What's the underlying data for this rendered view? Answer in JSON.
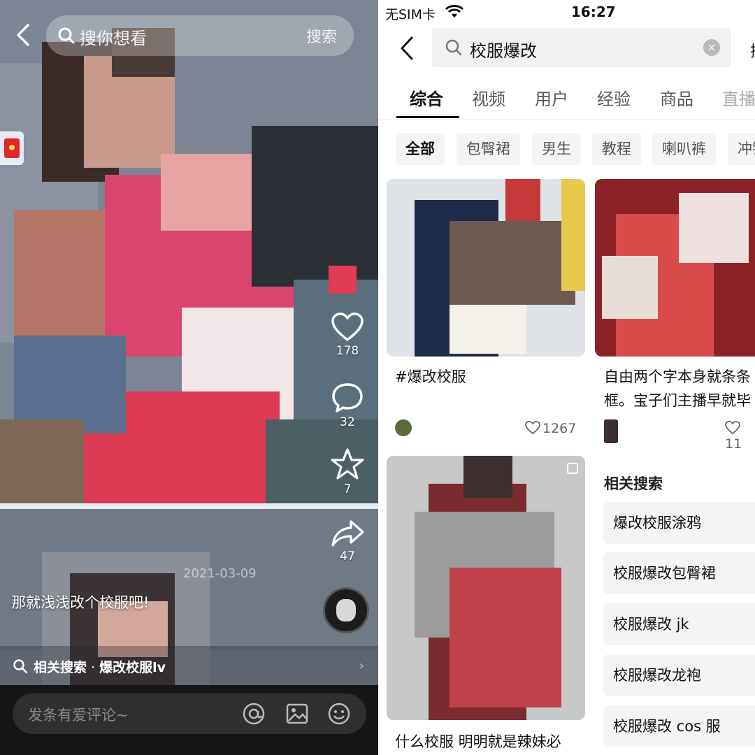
{
  "left_panel": {
    "search_placeholder": "搜你想看",
    "search_button": "搜索",
    "rail": {
      "likes": "178",
      "comments": "32",
      "favorites": "7",
      "shares": "47"
    },
    "caption": "那就浅浅改个校服吧!",
    "date": "2021-03-09",
    "related": {
      "label": "相关搜索",
      "separator": " · ",
      "query": "爆改校服lv"
    },
    "comment_placeholder": "发条有爱评论~",
    "icons": [
      "back-icon",
      "search-icon",
      "red-packet-icon",
      "heart-icon",
      "comment-icon",
      "star-icon",
      "share-icon",
      "at-icon",
      "image-icon",
      "emoji-icon"
    ]
  },
  "right_panel": {
    "status": {
      "carrier": "无SIM卡",
      "time": "16:27"
    },
    "search": {
      "query": "校服爆改",
      "button": "搜"
    },
    "tabs": [
      "综合",
      "视频",
      "用户",
      "经验",
      "商品",
      "直播"
    ],
    "active_tab": "综合",
    "chips": [
      "全部",
      "包臀裙",
      "男生",
      "教程",
      "喇叭裤",
      "冲锋"
    ],
    "active_chip": "全部",
    "cards": [
      {
        "title": "#爆改校服",
        "likes": "1267"
      },
      {
        "title_lines": [
          "自由两个字本身就条条",
          "框。宝子们主播早就毕"
        ],
        "likes": "11"
      },
      {
        "title": "什么校服 明明就是辣妹必"
      }
    ],
    "related_searches": {
      "heading": "相关搜索",
      "items": [
        "爆改校服涂鸦",
        "校服爆改包臀裙",
        "校服爆改 jk",
        "校服爆改龙袍",
        "校服爆改 cos 服"
      ]
    },
    "colors": {
      "text_primary": "#111111",
      "chip_bg": "#f4f4f5",
      "search_bg": "#f1f1f2"
    }
  }
}
